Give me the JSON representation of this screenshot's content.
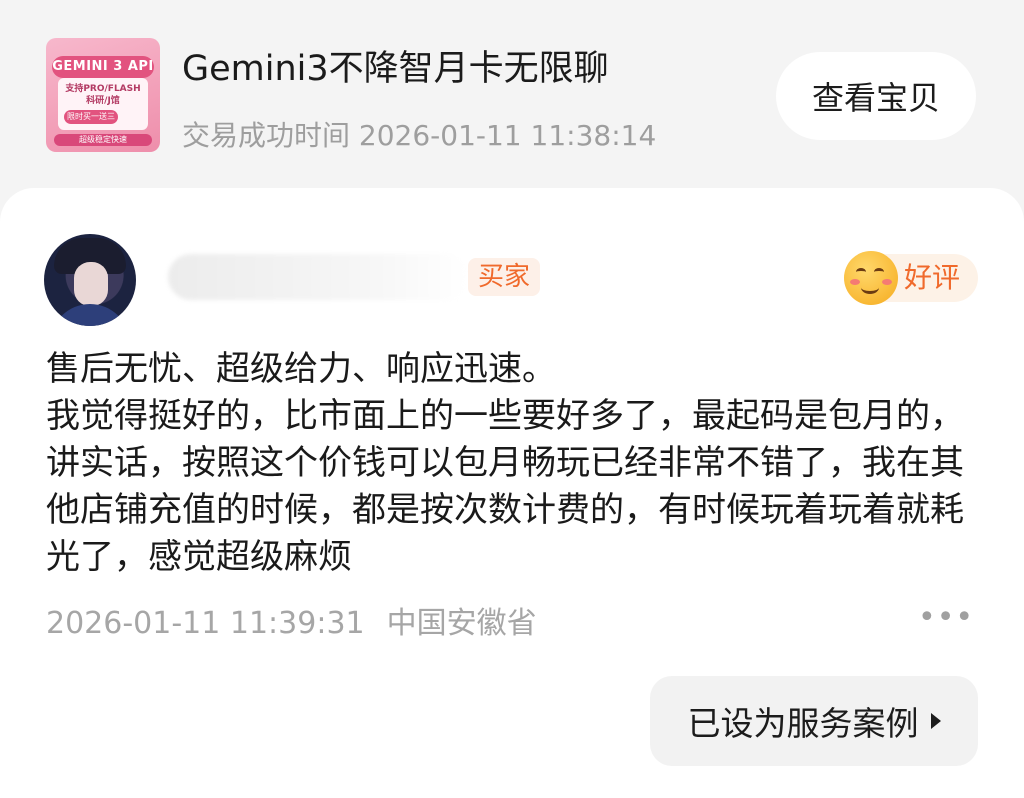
{
  "product": {
    "thumbnail": {
      "banner": "GEMINI 3 API",
      "line1": "支持PRO/FLASH",
      "line2": "科研/J馆",
      "pill": "限时买一送三",
      "footer": "超级稳定快速"
    },
    "title": "Gemini3不降智月卡无限聊",
    "transaction_time": "交易成功时间 2026-01-11 11:38:14",
    "view_button": "查看宝贝"
  },
  "review": {
    "user": {
      "role_tag": "买家"
    },
    "rating": {
      "label": "好评",
      "icon": "smiling-face-icon"
    },
    "paragraphs": [
      "售后无忧、超级给力、响应迅速。",
      "我觉得挺好的，比市面上的一些要好多了，最起码是包月的，讲实话，按照这个价钱可以包月畅玩已经非常不错了，我在其他店铺充值的时候，都是按次数计费的，有时候玩着玩着就耗光了，感觉超级麻烦"
    ],
    "timestamp": "2026-01-11 11:39:31",
    "location": "中国安徽省",
    "more_icon": "more-dots-icon",
    "service_case_button": "已设为服务案例"
  },
  "colors": {
    "accent_orange": "#f06a2c",
    "tag_background": "#fdf0e8",
    "muted_text": "#9e9e9e",
    "thumbnail_pink": "#f29fb8"
  }
}
